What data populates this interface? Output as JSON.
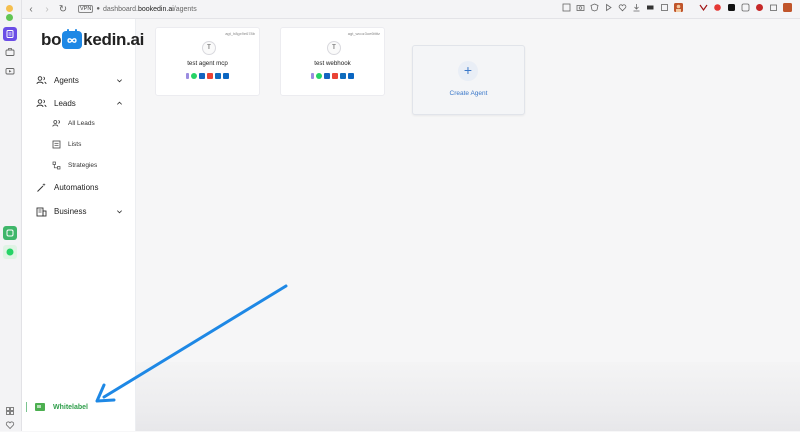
{
  "browser": {
    "url_prefix": "dashboard.",
    "url_domain": "bookedin.ai",
    "url_path": "/agents",
    "vpn_label": "VPN"
  },
  "sidebar": {
    "logo": {
      "part1": "bo",
      "part2": "kedin.ai"
    },
    "items": [
      {
        "label": "Agents",
        "icon": "users-icon",
        "expanded": false
      },
      {
        "label": "Leads",
        "icon": "users-icon",
        "expanded": true
      },
      {
        "label": "Automations",
        "icon": "magic-wand-icon",
        "expanded": false
      },
      {
        "label": "Business",
        "icon": "building-icon",
        "expanded": false
      }
    ],
    "lead_subitems": [
      {
        "label": "All Leads",
        "icon": "users-icon"
      },
      {
        "label": "Lists",
        "icon": "list-icon"
      },
      {
        "label": "Strategies",
        "icon": "flow-icon"
      }
    ],
    "whitelabel": "Whitelabel"
  },
  "agents": [
    {
      "id": "agt_h8gx9e678b",
      "initial": "T",
      "name": "test agent mcp"
    },
    {
      "id": "agt_wcoz3oe6ttttz",
      "initial": "T",
      "name": "test webhook"
    }
  ],
  "create_agent": {
    "plus": "+",
    "label": "Create Agent"
  },
  "colors": {
    "accent": "#1e88e5",
    "link": "#3a78c9",
    "whitelabel": "#2e9e4a",
    "arrow": "#1e88e5"
  }
}
